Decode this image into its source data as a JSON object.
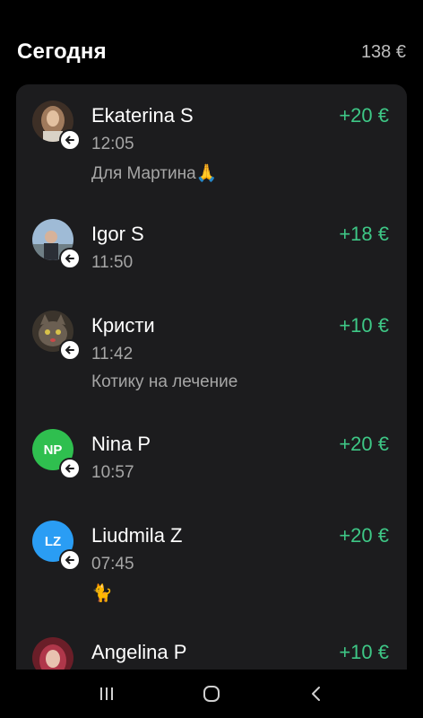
{
  "header": {
    "title": "Сегодня",
    "total": "138 €"
  },
  "transactions": [
    {
      "name": "Ekaterina S",
      "time": "12:05",
      "note": "Для Мартина🙏",
      "amount": "+20 €",
      "avatar": "photo",
      "avatar_color": "#8a6a52"
    },
    {
      "name": "Igor S",
      "time": "11:50",
      "note": "",
      "amount": "+18 €",
      "avatar": "photo",
      "avatar_color": "#6f8fb0"
    },
    {
      "name": "Кристи",
      "time": "11:42",
      "note": "Котику на лечение",
      "amount": "+10 €",
      "avatar": "photo",
      "avatar_color": "#4b4238"
    },
    {
      "name": "Nina P",
      "time": "10:57",
      "note": "",
      "amount": "+20 €",
      "avatar": "NP",
      "avatar_color": "#2fbf4f"
    },
    {
      "name": "Liudmila Z",
      "time": "07:45",
      "note": "🐈",
      "amount": "+20 €",
      "avatar": "LZ",
      "avatar_color": "#2a9df4"
    },
    {
      "name": "Angelina P",
      "time": "",
      "note": "",
      "amount": "+10 €",
      "avatar": "photo",
      "avatar_color": "#b0374a"
    }
  ],
  "colors": {
    "accent_income": "#3ec786",
    "card_bg": "#1c1c1e",
    "secondary_text": "#a6a6a6"
  },
  "icons": {
    "incoming": "arrow-left-icon",
    "nav_recents": "recents-icon",
    "nav_home": "home-icon",
    "nav_back": "back-icon"
  }
}
